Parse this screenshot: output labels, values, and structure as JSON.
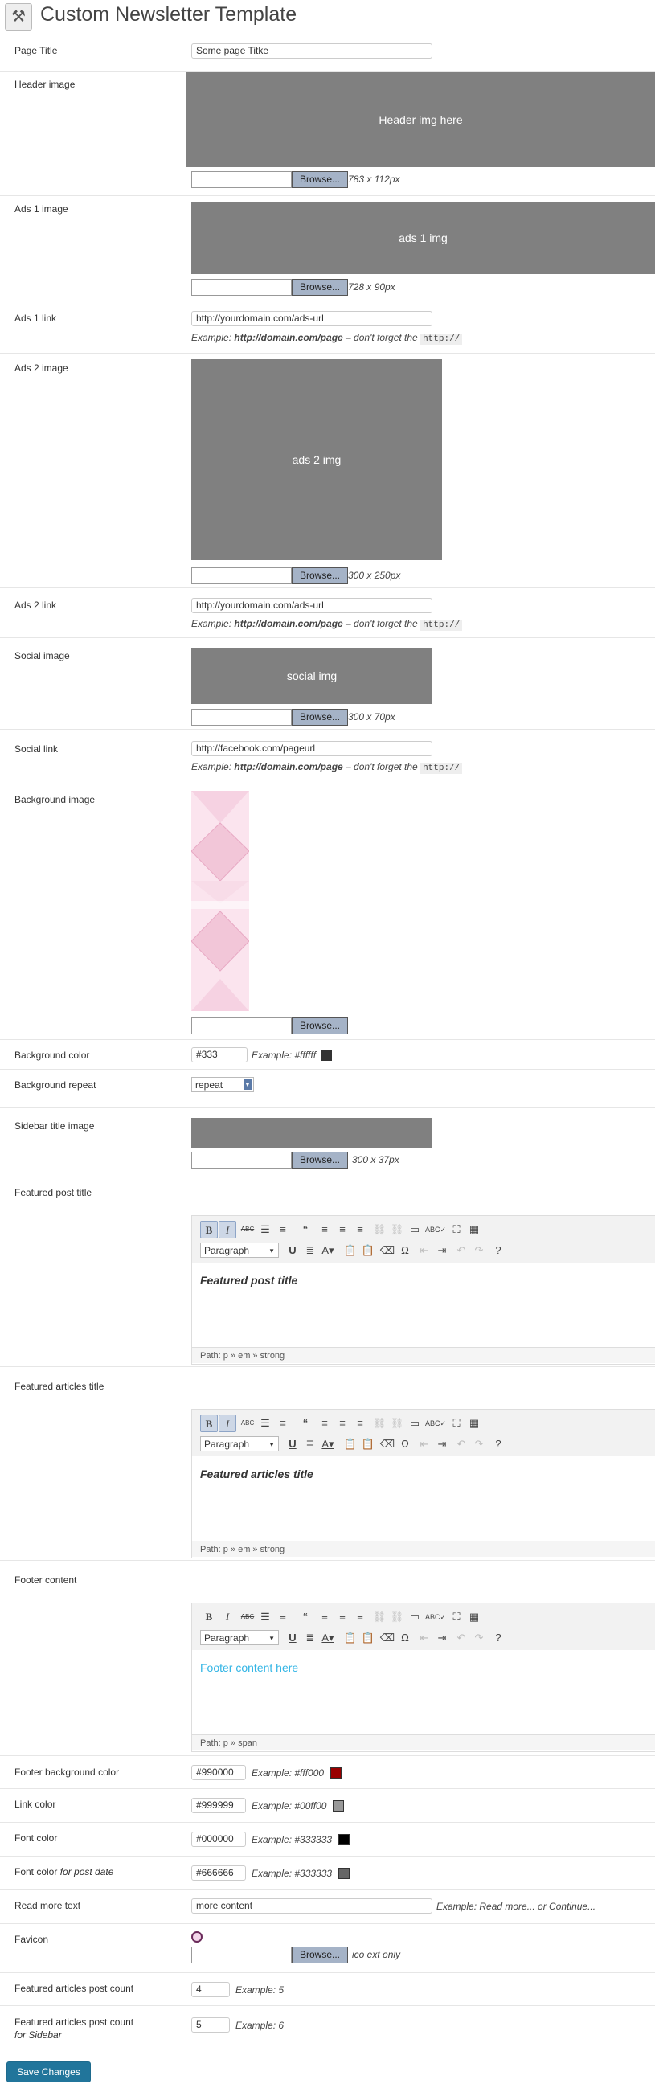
{
  "page": {
    "title": "Custom Newsletter Template",
    "save_label": "Save Changes"
  },
  "browse_label": "Browse...",
  "example_link_prefix": "Example: ",
  "example_link_url": "http://domain.com/page",
  "example_link_mid": " – don't forget the ",
  "example_link_code": "http://",
  "fields": {
    "page_title": {
      "label": "Page Title",
      "value": "Some page Titke"
    },
    "header_image": {
      "label": "Header image",
      "preview_text": "Header img here",
      "size": "783 x 112px"
    },
    "ads1_image": {
      "label": "Ads 1 image",
      "preview_text": "ads 1 img",
      "size": "728 x 90px"
    },
    "ads1_link": {
      "label": "Ads 1 link",
      "value": "http://yourdomain.com/ads-url"
    },
    "ads2_image": {
      "label": "Ads 2 image",
      "preview_text": "ads 2 img",
      "size": "300 x 250px"
    },
    "ads2_link": {
      "label": "Ads 2 link",
      "value": "http://yourdomain.com/ads-url"
    },
    "social_image": {
      "label": "Social image",
      "preview_text": "social img",
      "size": "300 x 70px"
    },
    "social_link": {
      "label": "Social link",
      "value": "http://facebook.com/pageurl"
    },
    "background_image": {
      "label": "Background image"
    },
    "background_color": {
      "label": "Background color",
      "value": "#333",
      "example": "Example: #ffffff",
      "swatch": "#333333"
    },
    "background_repeat": {
      "label": "Background repeat",
      "value": "repeat"
    },
    "sidebar_title_image": {
      "label": "Sidebar title image",
      "size": "300 x 37px"
    },
    "featured_post_title": {
      "label": "Featured post title",
      "format": "Paragraph",
      "content": "Featured post title",
      "path": "Path: p » em » strong"
    },
    "featured_articles_title": {
      "label": "Featured articles title",
      "format": "Paragraph",
      "content": "Featured articles title",
      "path": "Path: p » em » strong"
    },
    "footer_content": {
      "label": "Footer content",
      "format": "Paragraph",
      "content": "Footer content here",
      "content_color": "#33b5e5",
      "path": "Path: p » span"
    },
    "footer_bg_color": {
      "label": "Footer background color",
      "value": "#990000",
      "example": "Example: #fff000",
      "swatch": "#990000"
    },
    "link_color": {
      "label": "Link color",
      "value": "#999999",
      "example": "Example: #00ff00",
      "swatch": "#999999"
    },
    "font_color": {
      "label": "Font color",
      "value": "#000000",
      "example": "Example: #333333",
      "swatch": "#000000"
    },
    "font_color_post_date": {
      "label_main": "Font color ",
      "label_italic": "for post date",
      "value": "#666666",
      "example": "Example: #333333",
      "swatch": "#666666"
    },
    "read_more_text": {
      "label": "Read more text",
      "value": "more content",
      "example": "Example: Read more... or Continue..."
    },
    "favicon": {
      "label": "Favicon",
      "note": "ico ext only"
    },
    "featured_articles_post_count": {
      "label": "Featured articles post count",
      "value": "4",
      "example": "Example: 5"
    },
    "featured_articles_post_count_sidebar": {
      "label_main": "Featured articles post count",
      "label_italic": "for Sidebar",
      "value": "5",
      "example": "Example: 6"
    }
  },
  "toolbar_icons": [
    "bold",
    "italic",
    "strikethrough",
    "bullet-list",
    "numbered-list",
    "blockquote",
    "align-left",
    "align-center",
    "align-right",
    "link",
    "unlink",
    "more",
    "spellcheck",
    "fullscreen",
    "kitchen-sink",
    "underline",
    "justify",
    "text-color",
    "paste-text",
    "paste-word",
    "remove-format",
    "special-char",
    "outdent",
    "indent",
    "undo",
    "redo",
    "help"
  ]
}
